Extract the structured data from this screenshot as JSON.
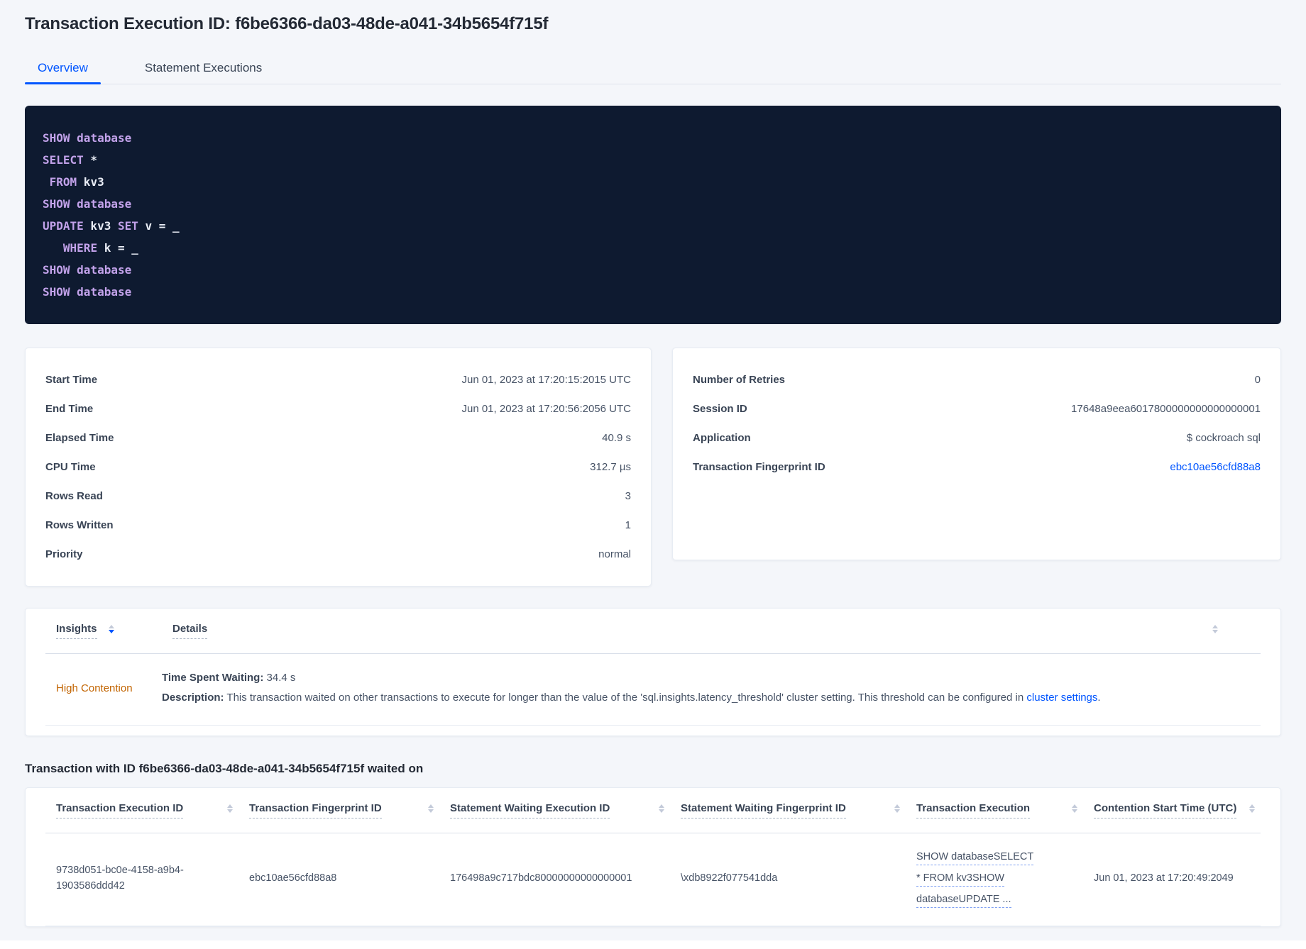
{
  "header": {
    "title": "Transaction Execution ID: f6be6366-da03-48de-a041-34b5654f715f"
  },
  "tabs": [
    {
      "label": "Overview",
      "active": true
    },
    {
      "label": "Statement Executions",
      "active": false
    }
  ],
  "sql": {
    "lines": [
      [
        {
          "c": "kw",
          "t": "SHOW"
        },
        {
          "c": "pl",
          "t": " "
        },
        {
          "c": "kw",
          "t": "database"
        }
      ],
      [
        {
          "c": "kw",
          "t": "SELECT"
        },
        {
          "c": "pl",
          "t": " *"
        }
      ],
      [
        {
          "c": "pl",
          "t": " "
        },
        {
          "c": "kw",
          "t": "FROM"
        },
        {
          "c": "pl",
          "t": " kv3"
        }
      ],
      [
        {
          "c": "kw",
          "t": "SHOW"
        },
        {
          "c": "pl",
          "t": " "
        },
        {
          "c": "kw",
          "t": "database"
        }
      ],
      [
        {
          "c": "kw",
          "t": "UPDATE"
        },
        {
          "c": "pl",
          "t": " kv3 "
        },
        {
          "c": "kw",
          "t": "SET"
        },
        {
          "c": "pl",
          "t": " v = _"
        }
      ],
      [
        {
          "c": "pl",
          "t": "   "
        },
        {
          "c": "kw",
          "t": "WHERE"
        },
        {
          "c": "pl",
          "t": " k = _"
        }
      ],
      [
        {
          "c": "kw",
          "t": "SHOW"
        },
        {
          "c": "pl",
          "t": " "
        },
        {
          "c": "kw",
          "t": "database"
        }
      ],
      [
        {
          "c": "kw",
          "t": "SHOW"
        },
        {
          "c": "pl",
          "t": " "
        },
        {
          "c": "kw",
          "t": "database"
        }
      ]
    ]
  },
  "summary_left": {
    "rows": [
      {
        "label": "Start Time",
        "value": "Jun 01, 2023 at 17:20:15:2015 UTC"
      },
      {
        "label": "End Time",
        "value": "Jun 01, 2023 at 17:20:56:2056 UTC"
      },
      {
        "label": "Elapsed Time",
        "value": "40.9 s"
      },
      {
        "label": "CPU Time",
        "value": "312.7 µs"
      },
      {
        "label": "Rows Read",
        "value": "3"
      },
      {
        "label": "Rows Written",
        "value": "1"
      },
      {
        "label": "Priority",
        "value": "normal"
      }
    ]
  },
  "summary_right": {
    "rows": [
      {
        "label": "Number of Retries",
        "value": "0"
      },
      {
        "label": "Session ID",
        "value": "17648a9eea6017800000000000000001"
      },
      {
        "label": "Application",
        "value": "$ cockroach sql"
      },
      {
        "label": "Transaction Fingerprint ID",
        "value": "ebc10ae56cfd88a8",
        "link": true
      }
    ]
  },
  "insights_table": {
    "col_insights": "Insights",
    "col_details": "Details",
    "row": {
      "insight": "High Contention",
      "waiting_label": "Time Spent Waiting:",
      "waiting_value": " 34.4 s",
      "description_label": "Description:",
      "description_text": " This transaction waited on other transactions to execute for longer than the value of the 'sql.insights.latency_threshold' cluster setting. This threshold can be configured in ",
      "description_link": "cluster settings",
      "description_suffix": "."
    }
  },
  "waited_on": {
    "heading": "Transaction with ID f6be6366-da03-48de-a041-34b5654f715f waited on",
    "columns": [
      "Transaction Execution ID",
      "Transaction Fingerprint ID",
      "Statement Waiting Execution ID",
      "Statement Waiting Fingerprint ID",
      "Transaction Execution",
      "Contention Start Time (UTC)"
    ],
    "rows": [
      {
        "transaction_execution_id": "9738d051-bc0e-4158-a9b4-1903586ddd42",
        "transaction_fingerprint_id": "ebc10ae56cfd88a8",
        "statement_waiting_execution_id": "176498a9c717bdc80000000000000001",
        "statement_waiting_fingerprint_id": "\\xdb8922f077541dda",
        "transaction_execution": "SHOW databaseSELECT * FROM kv3SHOW databaseUPDATE ...",
        "contention_start_time": "Jun 01, 2023 at 17:20:49:2049"
      }
    ]
  },
  "colors": {
    "accent": "#0055ff",
    "contention_orange": "#c26400",
    "sql_background": "#0e1a30",
    "sql_keyword": "#c2a2ea",
    "sql_plain": "#e9edf6"
  }
}
